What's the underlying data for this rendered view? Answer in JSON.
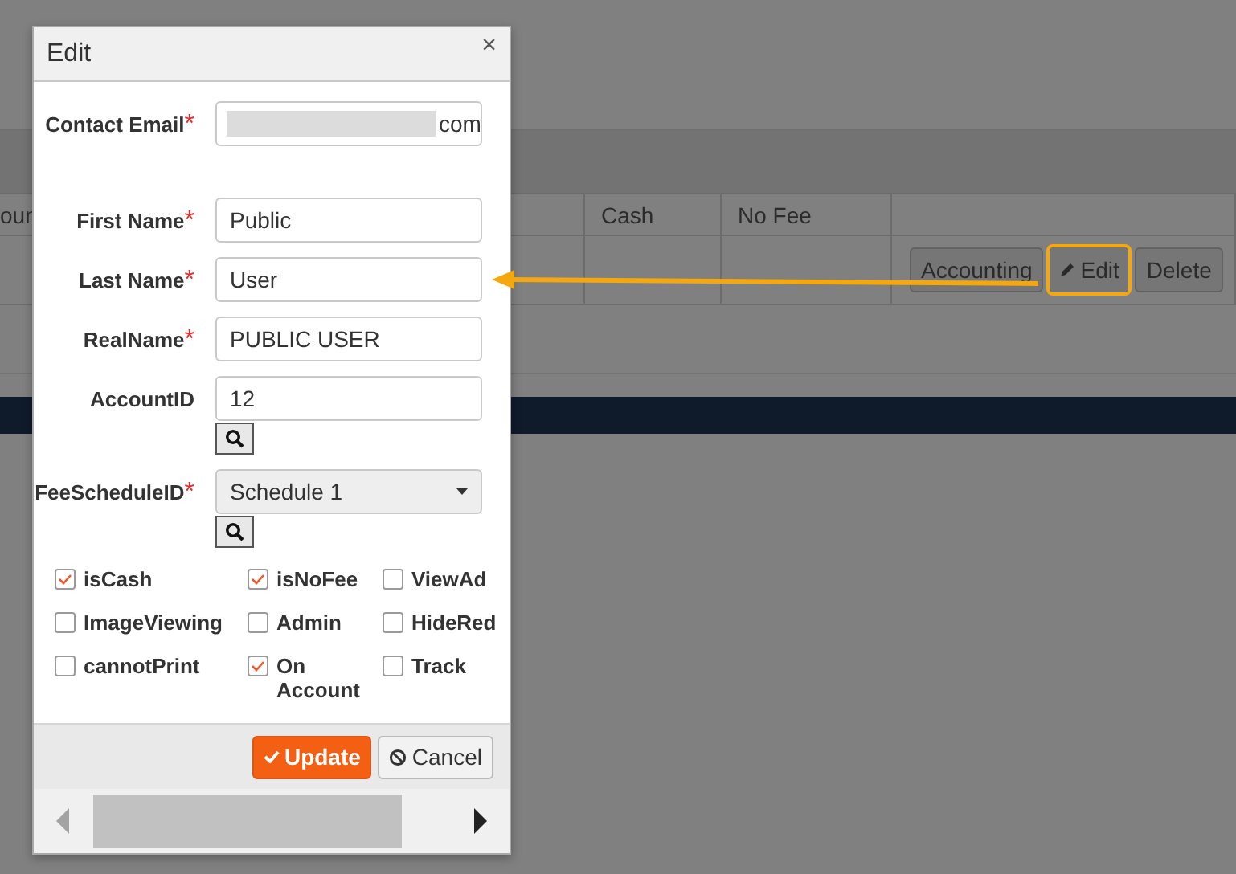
{
  "background_table": {
    "columns": [
      "oun",
      "Cash",
      "No Fee",
      ""
    ],
    "row_buttons": [
      {
        "kind": "plain",
        "label": "Accounting",
        "highlighted": false
      },
      {
        "kind": "edit",
        "label": "Edit",
        "highlighted": true
      },
      {
        "kind": "plain",
        "label": "Delete",
        "highlighted": false
      }
    ]
  },
  "dialog": {
    "title": "Edit",
    "close": "×",
    "fields": [
      {
        "kind": "redacted",
        "label": "Contact Email",
        "required_mark": "*",
        "value": "com",
        "lookup": false
      },
      {
        "kind": "text",
        "label": "First Name",
        "required_mark": "*",
        "value": "Public",
        "lookup": false
      },
      {
        "kind": "text",
        "label": "Last Name",
        "required_mark": "*",
        "value": "User",
        "lookup": false
      },
      {
        "kind": "text",
        "label": "RealName",
        "required_mark": "*",
        "value": "PUBLIC USER",
        "lookup": false
      },
      {
        "kind": "text",
        "label": "AccountID",
        "value": "12",
        "lookup": true
      },
      {
        "kind": "select",
        "label": "FeeScheduleID",
        "required_mark": "*",
        "value": "Schedule 1",
        "lookup": true
      }
    ],
    "checkboxes": [
      {
        "label": "isCash",
        "checked": true
      },
      {
        "label": "isNoFee",
        "checked": true
      },
      {
        "label": "ViewAd",
        "checked": false
      },
      {
        "label": "ImageViewing",
        "checked": false
      },
      {
        "label": "Admin",
        "checked": false
      },
      {
        "label": "HideRed",
        "checked": false
      },
      {
        "label": "cannotPrint",
        "checked": false
      },
      {
        "label": "On Account",
        "checked": true
      },
      {
        "label": "Track",
        "checked": false
      }
    ],
    "buttons": [
      {
        "kind": "primary",
        "label": "Update"
      },
      {
        "kind": "secondary",
        "label": "Cancel"
      }
    ]
  },
  "callout_arrow": true
}
